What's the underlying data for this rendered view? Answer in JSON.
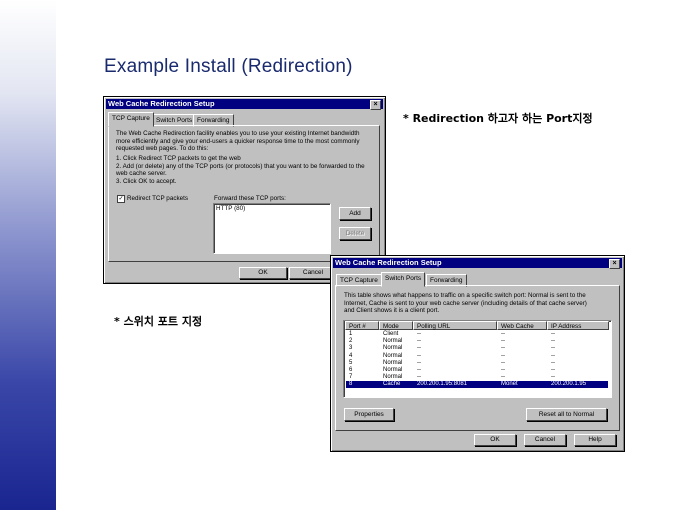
{
  "slide": {
    "title": "Example Install (Redirection)",
    "annotation_ports": "* Redirection 하고자 하는 Port지정",
    "annotation_switch": "* 스위치 포트 지정"
  },
  "dialog1": {
    "title": "Web Cache Redirection Setup",
    "close": "×",
    "tabs": [
      "TCP Capture",
      "Switch Ports",
      "Forwarding"
    ],
    "desc_lines": [
      "The Web Cache Redirection facility enables you to use your existing Internet bandwidth",
      "more efficiently and give your end-users a quicker response time to the most commonly",
      "requested web pages. To do this:",
      "1. Click Redirect TCP packets to get the web",
      "2. Add (or delete) any of the TCP ports (or protocols) that you want to be forwarded to the",
      "web cache server.",
      "3. Click OK to accept."
    ],
    "checkbox_label": "Redirect TCP packets",
    "checkbox_checked": true,
    "ports_label": "Forward these TCP ports:",
    "ports": [
      "HTTP (80)"
    ],
    "add_button": "Add",
    "delete_button": "Delete",
    "ok_button": "OK",
    "cancel_button": "Cancel"
  },
  "dialog2": {
    "title": "Web Cache Redirection Setup",
    "close": "×",
    "tabs": [
      "TCP Capture",
      "Switch Ports",
      "Forwarding"
    ],
    "desc_lines": [
      "This table shows what happens to traffic on a specific switch port: Normal is sent to the",
      "Internet, Cache is sent to your web cache server (including details of that cache server)",
      "and Client shows it is a client port."
    ],
    "columns": [
      "Port #",
      "Mode",
      "Polling URL",
      "Web Cache",
      "IP Address"
    ],
    "rows": [
      {
        "port": "1",
        "mode": "Client",
        "url": "--",
        "cache": "--",
        "ip": "--"
      },
      {
        "port": "2",
        "mode": "Normal",
        "url": "--",
        "cache": "--",
        "ip": "--"
      },
      {
        "port": "3",
        "mode": "Normal",
        "url": "--",
        "cache": "--",
        "ip": "--"
      },
      {
        "port": "4",
        "mode": "Normal",
        "url": "--",
        "cache": "--",
        "ip": "--"
      },
      {
        "port": "5",
        "mode": "Normal",
        "url": "--",
        "cache": "--",
        "ip": "--"
      },
      {
        "port": "6",
        "mode": "Normal",
        "url": "--",
        "cache": "--",
        "ip": "--"
      },
      {
        "port": "7",
        "mode": "Normal",
        "url": "--",
        "cache": "--",
        "ip": "--"
      },
      {
        "port": "8",
        "mode": "Cache",
        "url": "200.200.1.95:8081",
        "cache": "Monet",
        "ip": "200.200.1.95"
      }
    ],
    "selected_row": 7,
    "properties_button": "Properties",
    "reset_button": "Reset all to Normal",
    "ok_button": "OK",
    "cancel_button": "Cancel",
    "help_button": "Help"
  }
}
